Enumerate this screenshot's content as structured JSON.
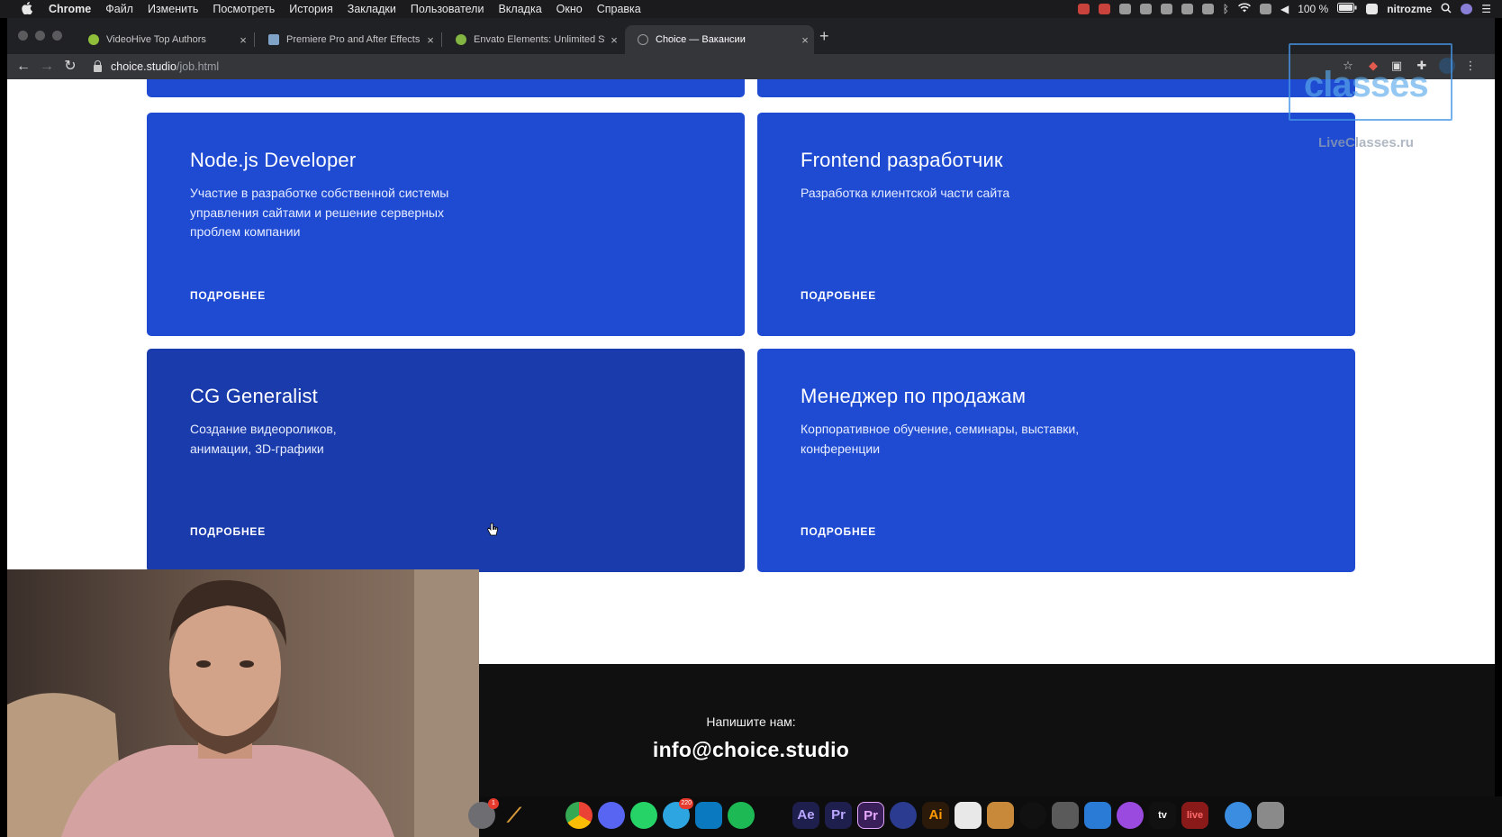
{
  "menubar": {
    "apple": "",
    "items": [
      "Chrome",
      "Файл",
      "Изменить",
      "Посмотреть",
      "История",
      "Закладки",
      "Пользователи",
      "Вкладка",
      "Окно",
      "Справка"
    ],
    "battery": "100 %",
    "user": "nitrozme"
  },
  "browser": {
    "tabs": [
      {
        "title": "VideoHive Top Authors",
        "icon": "videohive-favicon"
      },
      {
        "title": "Premiere Pro and After Effects",
        "icon": "premiere-favicon"
      },
      {
        "title": "Envato Elements: Unlimited St",
        "icon": "envato-favicon"
      },
      {
        "title": "Choice — Вакансии",
        "icon": "choice-favicon"
      }
    ],
    "active_tab": 3,
    "url_host": "choice.studio",
    "url_path": "/job.html"
  },
  "jobs": [
    {
      "title": "Node.js Developer",
      "description": "Участие в разработке собственной системы управления сайтами и решение серверных проблем компании",
      "more": "ПОДРОБНЕЕ"
    },
    {
      "title": "Frontend разработчик",
      "description": "Разработка клиентской части сайта",
      "more": "ПОДРОБНЕЕ"
    },
    {
      "title": "CG Generalist",
      "description": "Создание видеороликов, анимации, 3D-графики",
      "more": "ПОДРОБНЕЕ"
    },
    {
      "title": "Менеджер по продажам",
      "description": "Корпоративное обучение, семинары, выставки, конференции",
      "more": "ПОДРОБНЕЕ"
    }
  ],
  "footer": {
    "write_us": "Напишите нам:",
    "email": "info@choice.studio"
  },
  "watermark": {
    "logo": "classes",
    "site": "LiveClasses.ru"
  },
  "dock": {
    "apps": [
      {
        "name": "system-preferences",
        "label": "",
        "color": "#6d6d72",
        "badge": "1"
      },
      {
        "name": "cleanmymac",
        "label": "",
        "color": "#d89a3a",
        "badge": ""
      },
      {
        "name": "chrome",
        "label": "",
        "color": "#e9b22f",
        "badge": ""
      },
      {
        "name": "discord",
        "label": "",
        "color": "#5865f2",
        "badge": ""
      },
      {
        "name": "whatsapp",
        "label": "",
        "color": "#25d366",
        "badge": ""
      },
      {
        "name": "telegram",
        "label": "",
        "color": "#2ca5e0",
        "badge": "220"
      },
      {
        "name": "trello",
        "label": "",
        "color": "#0a79bf",
        "badge": ""
      },
      {
        "name": "spotify",
        "label": "",
        "color": "#1db954",
        "badge": ""
      },
      {
        "name": "after-effects",
        "label": "Ae",
        "color": "#1f1f4d",
        "badge": ""
      },
      {
        "name": "premiere-pro",
        "label": "Pr",
        "color": "#1f1f4d",
        "badge": ""
      },
      {
        "name": "premiere-rush",
        "label": "Pr",
        "color": "#3b1f5a",
        "badge": ""
      },
      {
        "name": "cinema-4d",
        "label": "",
        "color": "#2b3b8f",
        "badge": ""
      },
      {
        "name": "illustrator",
        "label": "Ai",
        "color": "#2b1a0a",
        "badge": ""
      },
      {
        "name": "figma",
        "label": "",
        "color": "#e8e8e8",
        "badge": ""
      },
      {
        "name": "keka",
        "label": "",
        "color": "#c88a3a",
        "badge": ""
      },
      {
        "name": "davinci",
        "label": "",
        "color": "#111111",
        "badge": ""
      },
      {
        "name": "calculator",
        "label": "",
        "color": "#5a5a5a",
        "badge": ""
      },
      {
        "name": "keynote",
        "label": "",
        "color": "#2a7bd6",
        "badge": ""
      },
      {
        "name": "podcasts",
        "label": "",
        "color": "#9b4ae0",
        "badge": ""
      },
      {
        "name": "apple-tv",
        "label": "tv",
        "color": "#111111",
        "badge": ""
      },
      {
        "name": "live-record",
        "label": "live",
        "color": "#8a1a1a",
        "badge": ""
      },
      {
        "name": "cloud-downloader",
        "label": "",
        "color": "#3a8de0",
        "badge": ""
      },
      {
        "name": "trash",
        "label": "",
        "color": "#8a8a8a",
        "badge": ""
      }
    ]
  }
}
